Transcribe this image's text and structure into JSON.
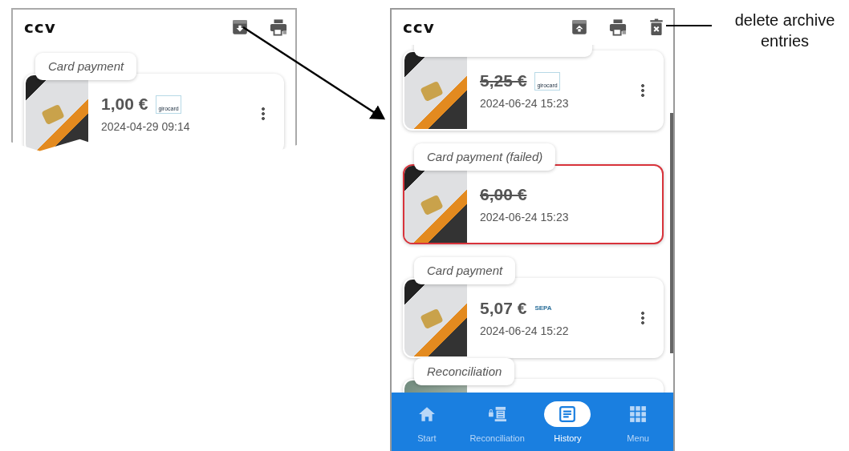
{
  "overview_panel": {
    "logo": "ccv",
    "header_icons": [
      {
        "kind": "archive-down"
      },
      {
        "kind": "print"
      }
    ],
    "transactions": [
      {
        "kind": "payment",
        "label": "Card payment",
        "amount": "1,00 €",
        "struck": false,
        "failed": false,
        "scheme": {
          "kind": "girocard",
          "text": "girocard"
        },
        "date": "2024-04-29 09:14",
        "has_menu": true
      }
    ]
  },
  "history_screen": {
    "logo": "ccv",
    "header_icons": [
      {
        "kind": "archive-up"
      },
      {
        "kind": "print"
      },
      {
        "kind": "delete"
      }
    ],
    "transactions": [
      {
        "kind": "payment",
        "amount": "5,25 €",
        "struck": true,
        "failed": false,
        "scheme": {
          "kind": "girocard",
          "text": "girocard"
        },
        "date": "2024-06-24 15:23",
        "has_menu": true
      },
      {
        "kind": "payment",
        "label": "Card payment (failed)",
        "amount": "6,00 €",
        "struck": true,
        "failed": true,
        "date": "2024-06-24 15:23",
        "has_menu": false
      },
      {
        "kind": "payment",
        "label": "Card payment",
        "amount": "5,07 €",
        "struck": false,
        "failed": false,
        "scheme": {
          "kind": "sepa",
          "text": "SEPA"
        },
        "date": "2024-06-24 15:22",
        "has_menu": true
      },
      {
        "kind": "reconciliation",
        "label": "Reconciliation"
      }
    ],
    "bottom_nav": [
      {
        "kind": "home",
        "label": "Start",
        "selected": false
      },
      {
        "kind": "register",
        "label": "Reconciliation",
        "selected": false
      },
      {
        "kind": "history",
        "label": "History",
        "selected": true
      },
      {
        "kind": "grid",
        "label": "Menu",
        "selected": false
      }
    ]
  },
  "annotation": {
    "text": "delete archive entries"
  }
}
